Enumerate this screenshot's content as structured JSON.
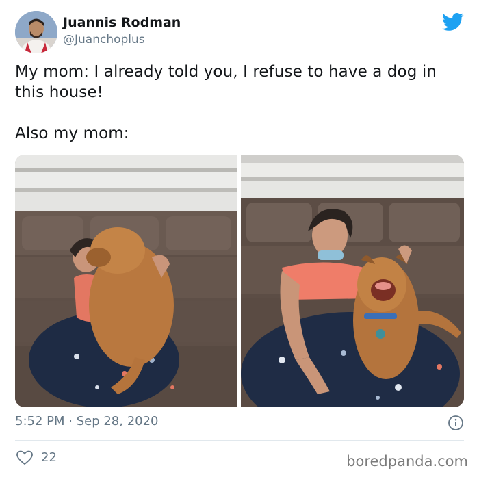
{
  "tweet": {
    "author_name": "Juannis Rodman",
    "author_handle": "@Juanchoplus",
    "text_line_1": "My mom: I already told you, I refuse to have a dog in this house!",
    "text_line_2": "Also my mom:",
    "timestamp": "5:52 PM · Sep 28, 2020",
    "like_count": "22"
  },
  "watermark": "boredpanda.com",
  "icons": {
    "brand": "twitter-bird-icon",
    "info": "info-icon",
    "like": "heart-icon"
  },
  "colors": {
    "brand_blue": "#1da1f2",
    "secondary_text": "#657786",
    "divider": "#e1e8ed"
  }
}
